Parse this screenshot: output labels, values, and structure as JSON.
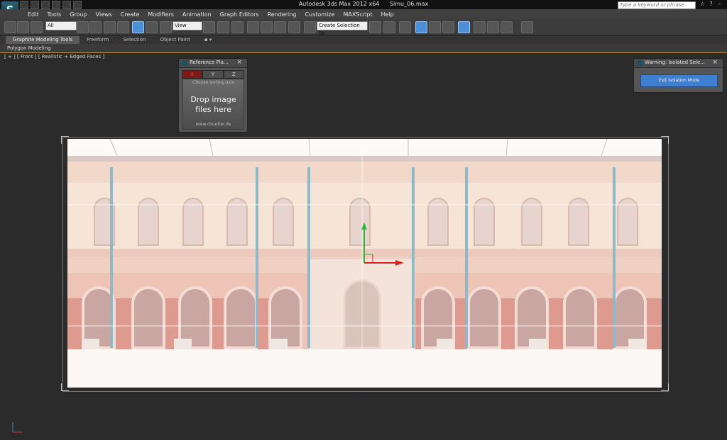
{
  "titlebar": {
    "app_name": "Autodesk 3ds Max  2012 x64",
    "file_name": "Simu_06.max",
    "search_placeholder": "Type a keyword or phrase"
  },
  "menubar": {
    "items": [
      "Edit",
      "Tools",
      "Group",
      "Views",
      "Create",
      "Modifiers",
      "Animation",
      "Graph Editors",
      "Rendering",
      "Customize",
      "MAXScript",
      "Help"
    ]
  },
  "toolbar": {
    "selection_filter": "All",
    "reference_coord": "View",
    "named_selection": "Create Selection Se"
  },
  "ribbon": {
    "tabs": [
      "Graphite Modeling Tools",
      "Freeform",
      "Selection",
      "Object Paint"
    ],
    "active_tab": 0,
    "panel_label": "Polygon Modeling"
  },
  "viewport": {
    "label": "[ + ] [ Front ] [ Realistic + Edged Faces ]"
  },
  "reference_panel": {
    "title": "Reference Pla...",
    "axes": [
      "X",
      "Y",
      "Z"
    ],
    "selected_axis": "X",
    "sort_hint": "Choose sorting axis",
    "drop_text_line1": "Drop image",
    "drop_text_line2": "files here",
    "url": "www.cbuelter.de"
  },
  "warning_panel": {
    "title": "Warning: Isolated Sele...",
    "button": "Exit Isolation Mode"
  },
  "colors": {
    "accent_blue": "#3f7fd1",
    "viewport_border": "#c39b3d",
    "axis_selected": "#7d1a18"
  }
}
